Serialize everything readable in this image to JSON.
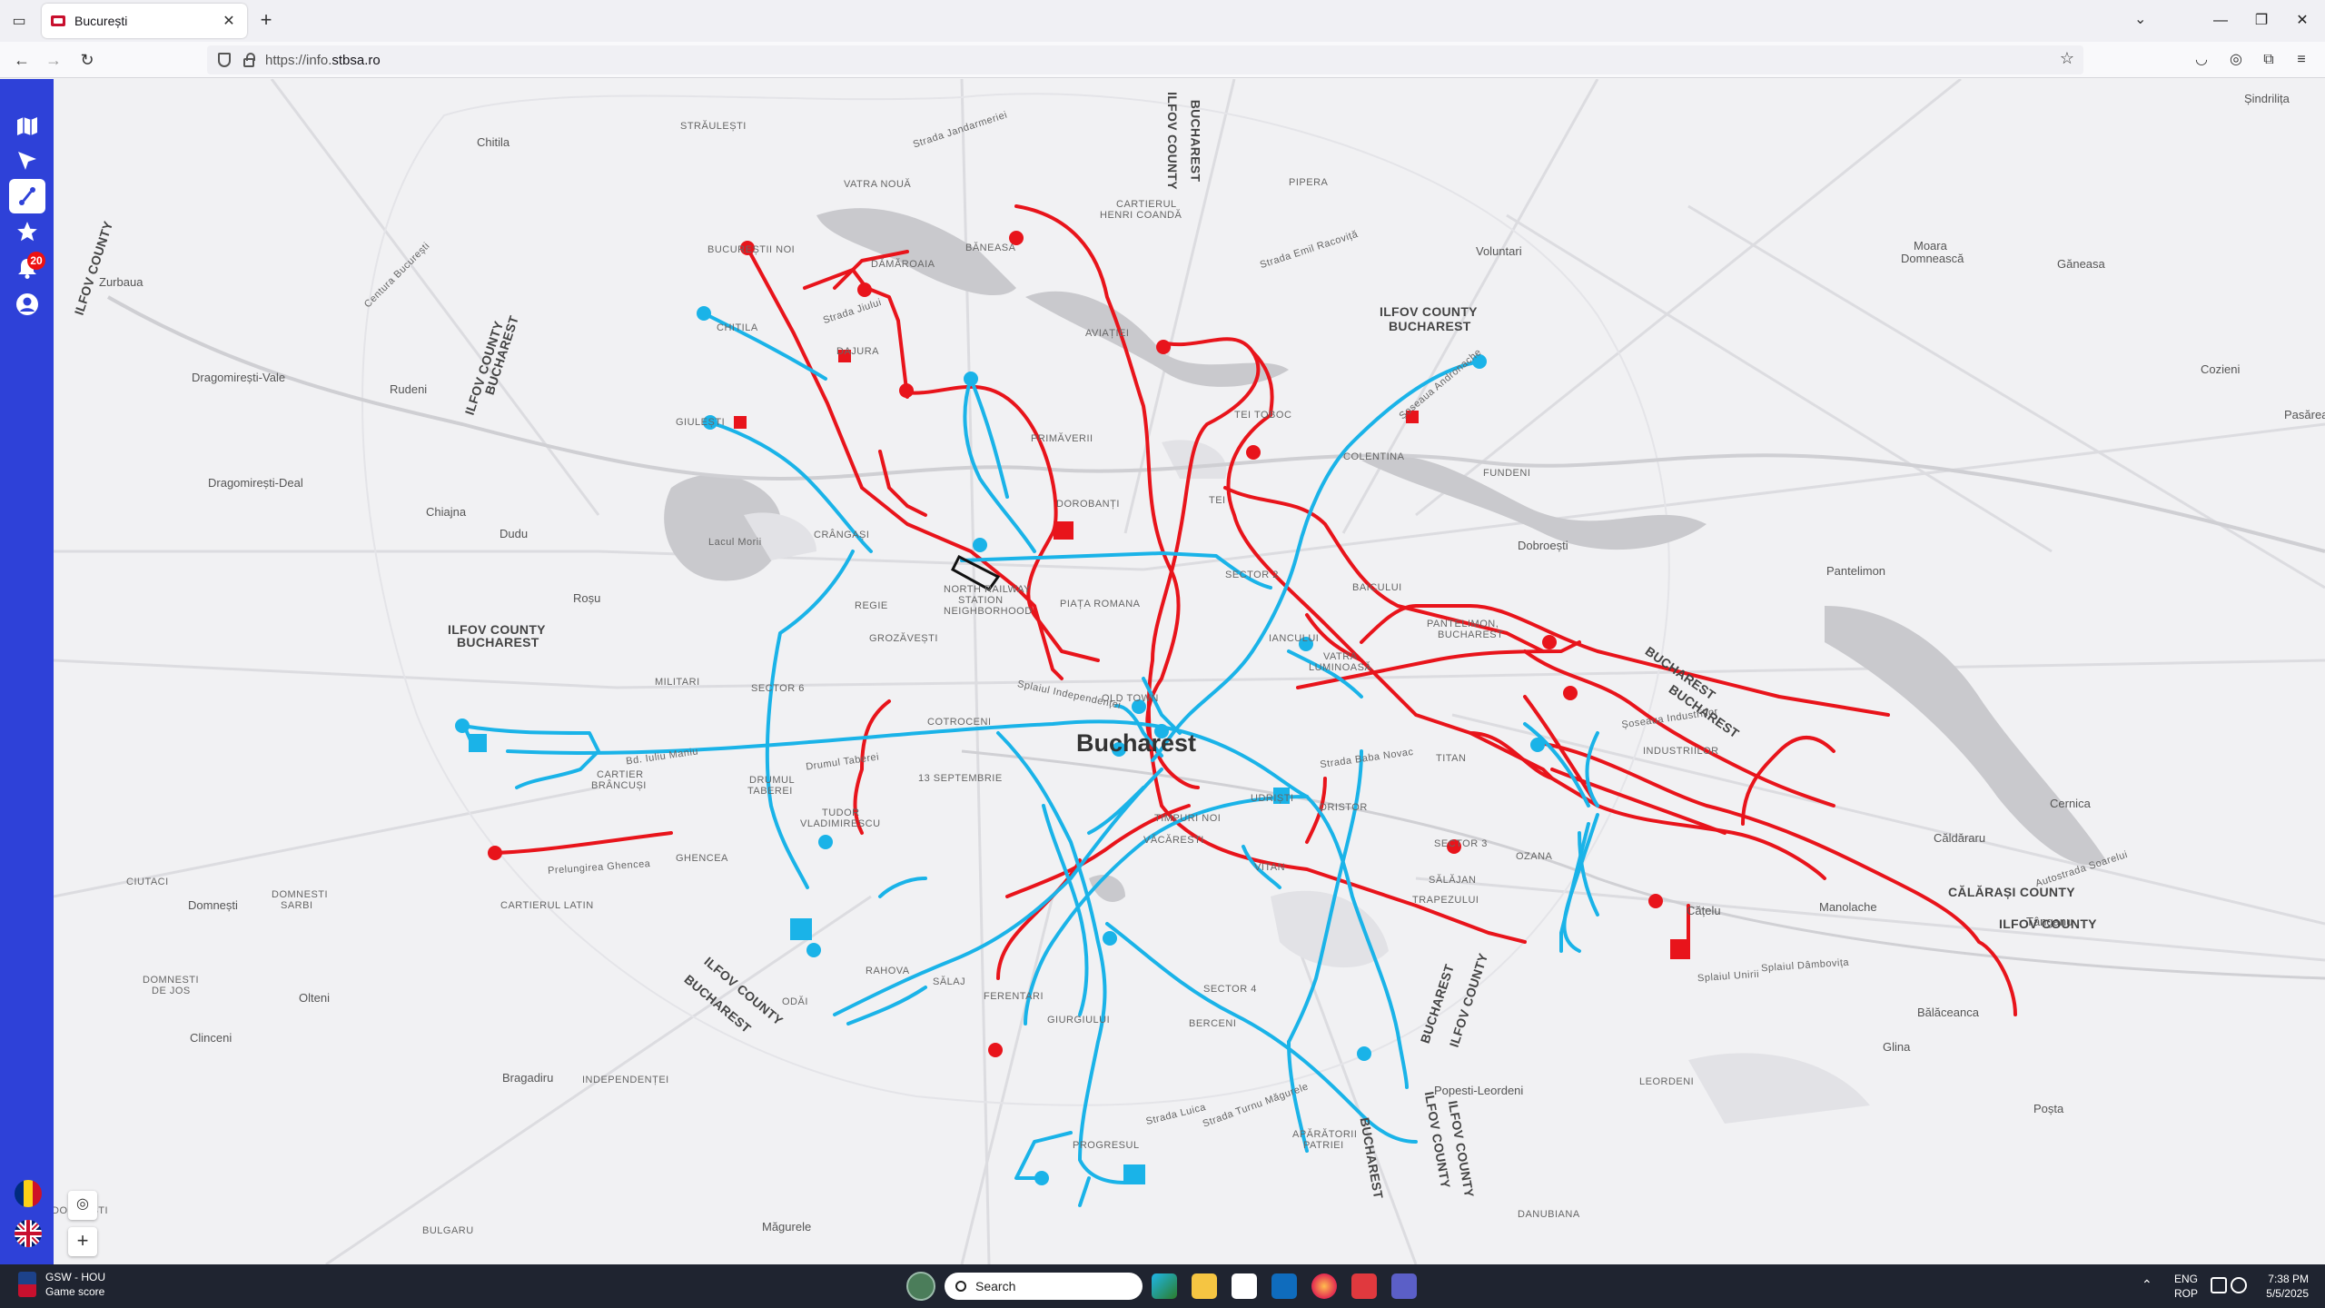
{
  "browser": {
    "tab_title": "București",
    "url_prefix": "https://info.",
    "url_domain": "stbsa.ro",
    "new_tab_symbol": "+",
    "close_symbol": "✕",
    "icons": [
      "tab-list-icon",
      "back-icon",
      "forward-icon",
      "reload-icon",
      "shield-icon",
      "lock-icon",
      "bookmark-star-icon",
      "pocket-icon",
      "account-icon",
      "extensions-icon",
      "menu-icon",
      "minimize-icon",
      "maximize-icon",
      "close-icon"
    ]
  },
  "sidebar": {
    "items": [
      {
        "name": "map",
        "icon": "map-icon"
      },
      {
        "name": "navigate",
        "icon": "navigation-arrow-icon"
      },
      {
        "name": "routes",
        "icon": "route-icon",
        "active": true
      },
      {
        "name": "favorites",
        "icon": "star-icon"
      },
      {
        "name": "notifications",
        "icon": "bell-icon",
        "badge": "20"
      },
      {
        "name": "account",
        "icon": "user-icon"
      }
    ],
    "languages": [
      {
        "name": "Romanian",
        "icon": "romania-flag-icon"
      },
      {
        "name": "English",
        "icon": "uk-flag-icon"
      }
    ]
  },
  "map": {
    "city_label": "Bucharest",
    "colors": {
      "red_routes": "#e8141b",
      "blue_routes": "#1ab3e8",
      "background": "#f1f1f3",
      "water": "#c8c8cc",
      "park": "#dedee2"
    },
    "labels": [
      {
        "text": "Chitila",
        "cls": ""
      },
      {
        "text": "STRĂULEȘTI",
        "cls": "small"
      },
      {
        "text": "VATRA NOUĂ",
        "cls": "small"
      },
      {
        "text": "BUCUREȘTII NOI",
        "cls": "small"
      },
      {
        "text": "DĂMĂROAIA",
        "cls": "small"
      },
      {
        "text": "BĂNEASA",
        "cls": "small"
      },
      {
        "text": "CARTIERUL",
        "cls": "small"
      },
      {
        "text": "HENRI COANDĂ",
        "cls": "small"
      },
      {
        "text": "PIPERA",
        "cls": "small"
      },
      {
        "text": "Voluntari",
        "cls": ""
      },
      {
        "text": "Moara",
        "cls": ""
      },
      {
        "text": "Domnească",
        "cls": ""
      },
      {
        "text": "Găneasa",
        "cls": ""
      },
      {
        "text": "Șindrilița",
        "cls": ""
      },
      {
        "text": "Zurbaua",
        "cls": ""
      },
      {
        "text": "CHITILA",
        "cls": "small"
      },
      {
        "text": "DAJURA",
        "cls": "small"
      },
      {
        "text": "AVIAȚIEI",
        "cls": "small"
      },
      {
        "text": "Dragomirești-Vale",
        "cls": ""
      },
      {
        "text": "Rudeni",
        "cls": ""
      },
      {
        "text": "GIULEȘTI",
        "cls": "small"
      },
      {
        "text": "PRIMĂVERII",
        "cls": "small"
      },
      {
        "text": "TEI TOBOC",
        "cls": "small"
      },
      {
        "text": "COLENTINA",
        "cls": "small"
      },
      {
        "text": "Cozieni",
        "cls": ""
      },
      {
        "text": "Pasărea",
        "cls": ""
      },
      {
        "text": "Dragomirești-Deal",
        "cls": ""
      },
      {
        "text": "Chiajna",
        "cls": ""
      },
      {
        "text": "Dudu",
        "cls": ""
      },
      {
        "text": "DOROBANȚI",
        "cls": "small"
      },
      {
        "text": "TEI",
        "cls": "small"
      },
      {
        "text": "FUNDENI",
        "cls": "small"
      },
      {
        "text": "Dobroești",
        "cls": ""
      },
      {
        "text": "Pantelimon",
        "cls": ""
      },
      {
        "text": "Lacul Morii",
        "cls": "small"
      },
      {
        "text": "CRÂNGAȘI",
        "cls": "small"
      },
      {
        "text": "NORTH RAILWAY",
        "cls": "small"
      },
      {
        "text": "STATION",
        "cls": "small"
      },
      {
        "text": "NEIGHBORHOOD",
        "cls": "small"
      },
      {
        "text": "PIAȚA ROMANA",
        "cls": "small"
      },
      {
        "text": "BAICULUI",
        "cls": "small"
      },
      {
        "text": "Roșu",
        "cls": ""
      },
      {
        "text": "REGIE",
        "cls": "small"
      },
      {
        "text": "GROZĂVEȘTI",
        "cls": "small"
      },
      {
        "text": "IANCULUI",
        "cls": "small"
      },
      {
        "text": "VATRA",
        "cls": "small"
      },
      {
        "text": "LUMINOASĂ",
        "cls": "small"
      },
      {
        "text": "PANTELIMON,",
        "cls": "small"
      },
      {
        "text": "BUCHAREST",
        "cls": "small"
      },
      {
        "text": "MILITARI",
        "cls": "small"
      },
      {
        "text": "OLD TOWN",
        "cls": "small"
      },
      {
        "text": "COTROCENI",
        "cls": "small"
      },
      {
        "text": "INDUSTRIILOR",
        "cls": "small"
      },
      {
        "text": "CARTIER",
        "cls": "small"
      },
      {
        "text": "BRÂNCUȘI",
        "cls": "small"
      },
      {
        "text": "DRUMUL",
        "cls": "small"
      },
      {
        "text": "TABEREI",
        "cls": "small"
      },
      {
        "text": "13 SEPTEMBRIE",
        "cls": "small"
      },
      {
        "text": "TITAN",
        "cls": "small"
      },
      {
        "text": "Cernica",
        "cls": ""
      },
      {
        "text": "TUDOR",
        "cls": "small"
      },
      {
        "text": "VLADIMIRESCU",
        "cls": "small"
      },
      {
        "text": "UDRIȘTI",
        "cls": "small"
      },
      {
        "text": "DRISTOR",
        "cls": "small"
      },
      {
        "text": "TIMPURI NOI",
        "cls": "small"
      },
      {
        "text": "VĂCĂRESTI",
        "cls": "small"
      },
      {
        "text": "Căldăraru",
        "cls": ""
      },
      {
        "text": "GHENCEA",
        "cls": "small"
      },
      {
        "text": "OZANA",
        "cls": "small"
      },
      {
        "text": "VITAN",
        "cls": "small"
      },
      {
        "text": "SĂLĂJAN",
        "cls": "small"
      },
      {
        "text": "CIUTACI",
        "cls": "small"
      },
      {
        "text": "Domnești",
        "cls": ""
      },
      {
        "text": "DOMNESTI",
        "cls": "small"
      },
      {
        "text": "SARBI",
        "cls": "small"
      },
      {
        "text": "CARTIERUL LATIN",
        "cls": "small"
      },
      {
        "text": "TRAPEZULUI",
        "cls": "small"
      },
      {
        "text": "Cățelu",
        "cls": ""
      },
      {
        "text": "Manolache",
        "cls": ""
      },
      {
        "text": "Tânganu",
        "cls": ""
      },
      {
        "text": "RAHOVA",
        "cls": "small"
      },
      {
        "text": "SĂLAJ",
        "cls": "small"
      },
      {
        "text": "FERENTARI",
        "cls": "small"
      },
      {
        "text": "DOMNESTI",
        "cls": "small"
      },
      {
        "text": "DE JOS",
        "cls": "small"
      },
      {
        "text": "Olteni",
        "cls": ""
      },
      {
        "text": "ODĂI",
        "cls": "small"
      },
      {
        "text": "GIURGIULUI",
        "cls": "small"
      },
      {
        "text": "BERCENI",
        "cls": "small"
      },
      {
        "text": "Bălăceanca",
        "cls": ""
      },
      {
        "text": "Clinceni",
        "cls": ""
      },
      {
        "text": "Glina",
        "cls": ""
      },
      {
        "text": "Bragadiru",
        "cls": ""
      },
      {
        "text": "INDEPENDENȚEI",
        "cls": "small"
      },
      {
        "text": "Popesti-Leordeni",
        "cls": ""
      },
      {
        "text": "LEORDENI",
        "cls": "small"
      },
      {
        "text": "Poșta",
        "cls": ""
      },
      {
        "text": "APĂRĂTORII",
        "cls": "small"
      },
      {
        "text": "PATRIEI",
        "cls": "small"
      },
      {
        "text": "PROGRESUL",
        "cls": "small"
      },
      {
        "text": "Măgurele",
        "cls": ""
      },
      {
        "text": "DANUBIANA",
        "cls": "small"
      },
      {
        "text": "BULGARU",
        "cls": "small"
      },
      {
        "text": "DOMNESTI",
        "cls": "small"
      }
    ],
    "county_labels": [
      "ILFOV COUNTY",
      "BUCHAREST",
      "ILFOV COUNTY",
      "BUCHAREST",
      "ILFOV COUNTY",
      "BUCHAREST",
      "ILFOV COUNTY",
      "BUCHAREST",
      "ILFOV COUNTY",
      "BUCHAREST",
      "BUCHAREST",
      "ILFOV COUNTY",
      "BUCHAREST",
      "ILFOV COUNTY",
      "CĂLĂRAȘI COUNTY",
      "ILFOV COUNTY",
      "BUCHAREST",
      "ILFOV COUNTY",
      "BUCHAREST",
      "ILFOV COUNTY"
    ],
    "road_labels": [
      "Centura București",
      "Splaiul Independenței",
      "Bd. Iuliu Maniu",
      "Drumul Taberei",
      "Prelungirea Ghencea",
      "Strada Baba Novac",
      "Șoseaua Industriilor",
      "Splaiul Unirii",
      "Strada Luica",
      "Strada Turnu Măgurele",
      "Șoseaua Andronache",
      "Strada Emil Racoviță",
      "Strada Jandarmeriei",
      "Strada Jiului",
      "Splaiul Dâmbovița",
      "Autostrada Soarelui",
      "SECTOR 6",
      "SECTOR 2",
      "SECTOR 3",
      "SECTOR 4"
    ],
    "controls": {
      "locate_icon": "locate-icon",
      "zoom_in": "+"
    }
  },
  "taskbar": {
    "news_title": "GSW - HOU",
    "news_subtitle": "Game score",
    "search_placeholder": "Search",
    "apps": [
      "edge-icon",
      "file-explorer-icon",
      "store-icon",
      "outlook-icon",
      "firefox-icon",
      "media-icon",
      "teams-icon"
    ],
    "lang_line1": "ENG",
    "lang_line2": "ROP",
    "time": "7:38 PM",
    "date": "5/5/2025"
  }
}
